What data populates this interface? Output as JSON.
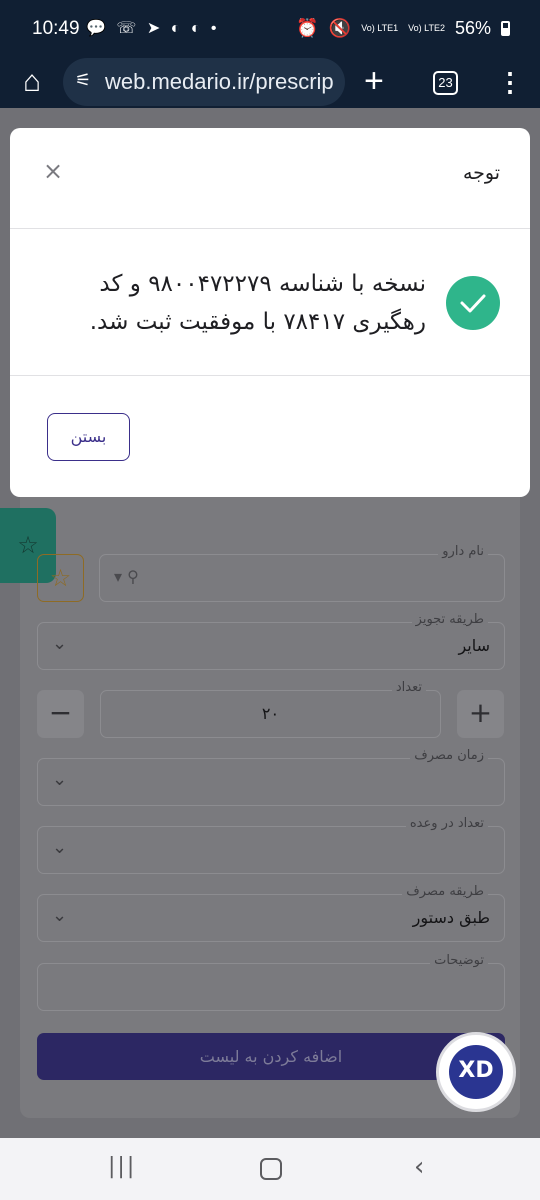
{
  "status_bar": {
    "time": "10:49",
    "notification_icons": "💬 ☏ ➤ ◐ ◐ •",
    "net1": "Vo) LTE1",
    "net2": "Vo) LTE2",
    "battery": "56%"
  },
  "browser": {
    "url": "web.medario.ir/prescrip",
    "tab_count": "23"
  },
  "page": {
    "drug_name_label": "نام دارو",
    "prescription_method_label": "طریقه تجویز",
    "prescription_method_value": "سایر",
    "quantity_label": "تعداد",
    "quantity_value": "۲۰",
    "usage_time_label": "زمان مصرف",
    "dose_count_label": "تعداد در وعده",
    "usage_method_label": "طریقه مصرف",
    "usage_method_value": "طبق دستور",
    "notes_label": "توضیحات",
    "add_to_list_label": "اضافه کردن به لیست",
    "brand_logo_text": "XD"
  },
  "modal": {
    "title": "توجه",
    "message": "نسخه با شناسه ۹۸۰۰۴۷۲۲۷۹ و کد رهگیری ۷۸۴۱۷ با موفقیت ثبت شد.",
    "close_button": "بستن"
  },
  "colors": {
    "success": "#2fb58b",
    "primary": "#3b2f8a"
  }
}
